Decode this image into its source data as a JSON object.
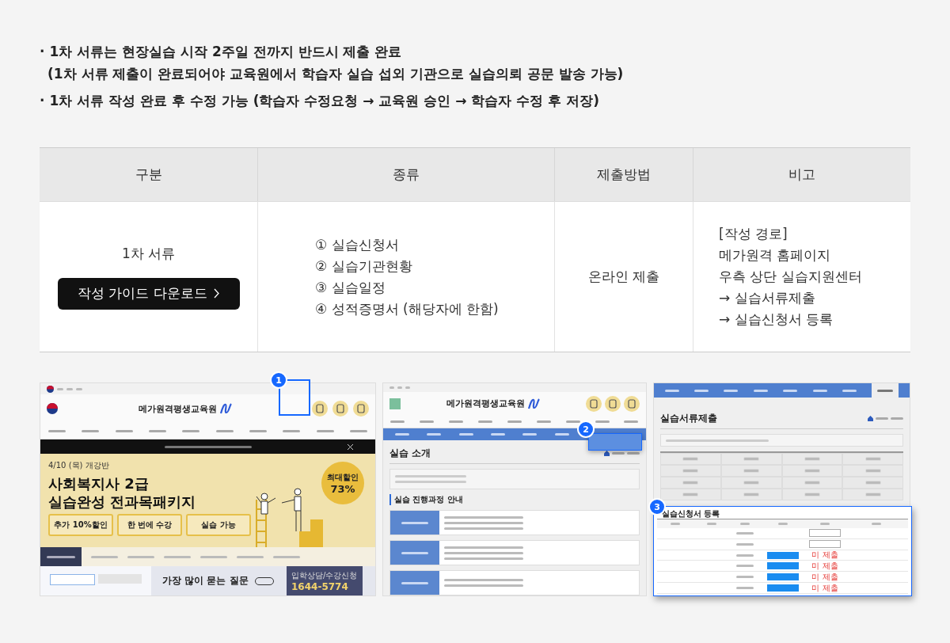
{
  "notes": [
    {
      "text": "· 1차 서류는 현장실습 시작 2주일 전까지 반드시 제출 완료",
      "kind": "bullet"
    },
    {
      "text": "(1차 서류 제출이 완료되어야 교육원에서 학습자 실습 섭외 기관으로 실습의뢰 공문 발송 가능)",
      "kind": "continuation"
    },
    {
      "text": "· 1차 서류 작성 완료 후 수정 가능 (학습자 수정요청 → 교육원 승인 → 학습자 수정 후 저장)",
      "kind": "bullet"
    }
  ],
  "table": {
    "columns": [
      "구분",
      "종류",
      "제출방법",
      "비고"
    ],
    "rows": [
      {
        "category": "1차 서류",
        "guide_button": "작성 가이드 다운로드",
        "documents": [
          "① 실습신청서",
          "② 실습기관현황",
          "③ 실습일정",
          "④ 성적증명서 (해당자에 한함)"
        ],
        "method": "온라인 제출",
        "remarks": [
          "[작성 경로]",
          "메가원격 홈페이지",
          "우측 상단 실습지원센터",
          "→ 실습서류제출",
          "→ 실습신청서 등록"
        ]
      }
    ]
  },
  "screenshots": [
    {
      "badge": "1",
      "logo": "메가원격평생교육원",
      "banner_date": "4/10 (목) 개강반",
      "banner_title": [
        "사회복지사 2급",
        "실습완성 전과목패키지"
      ],
      "discount_label": "최대할인",
      "discount": "73%",
      "benefits": [
        "추가 10%할인",
        "한 번에 수강",
        "실습 가능"
      ],
      "faq_title": "가장 많이 묻는 질문",
      "contact_label": "입학상담/수강신청",
      "phone": "1644-5774"
    },
    {
      "badge": "2",
      "logo": "메가원격평생교육원",
      "page_title": "실습 소개",
      "section_title": "실습 진행과정 안내"
    },
    {
      "badge": "3",
      "page_title": "실습서류제출",
      "panel_title": "실습신청서 등록",
      "status": [
        "미 제출",
        "미 제출",
        "미 제출",
        "미 제출"
      ]
    }
  ]
}
